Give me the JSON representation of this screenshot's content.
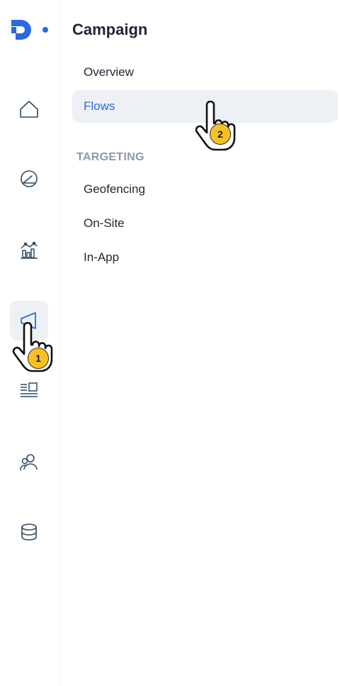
{
  "sidebar": {
    "brand_accent": "#2a6ae0",
    "icons": [
      {
        "name": "home-icon"
      },
      {
        "name": "gauge-icon"
      },
      {
        "name": "analytics-icon"
      },
      {
        "name": "megaphone-icon",
        "active": true
      },
      {
        "name": "content-icon"
      },
      {
        "name": "audience-icon"
      },
      {
        "name": "database-icon"
      }
    ]
  },
  "panel": {
    "title": "Campaign",
    "items": [
      {
        "label": "Overview"
      },
      {
        "label": "Flows",
        "active": true
      }
    ],
    "section_heading": "TARGETING",
    "targeting_items": [
      {
        "label": "Geofencing"
      },
      {
        "label": "On-Site"
      },
      {
        "label": "In-App"
      }
    ]
  },
  "steps": [
    {
      "number": "1"
    },
    {
      "number": "2"
    }
  ],
  "colors": {
    "active_bg": "#edf1f5",
    "active_text": "#2a6ae0",
    "heading_gray": "#8d97a5",
    "icon_stroke": "#2d4a64",
    "badge_yellow": "#f7c21f"
  }
}
